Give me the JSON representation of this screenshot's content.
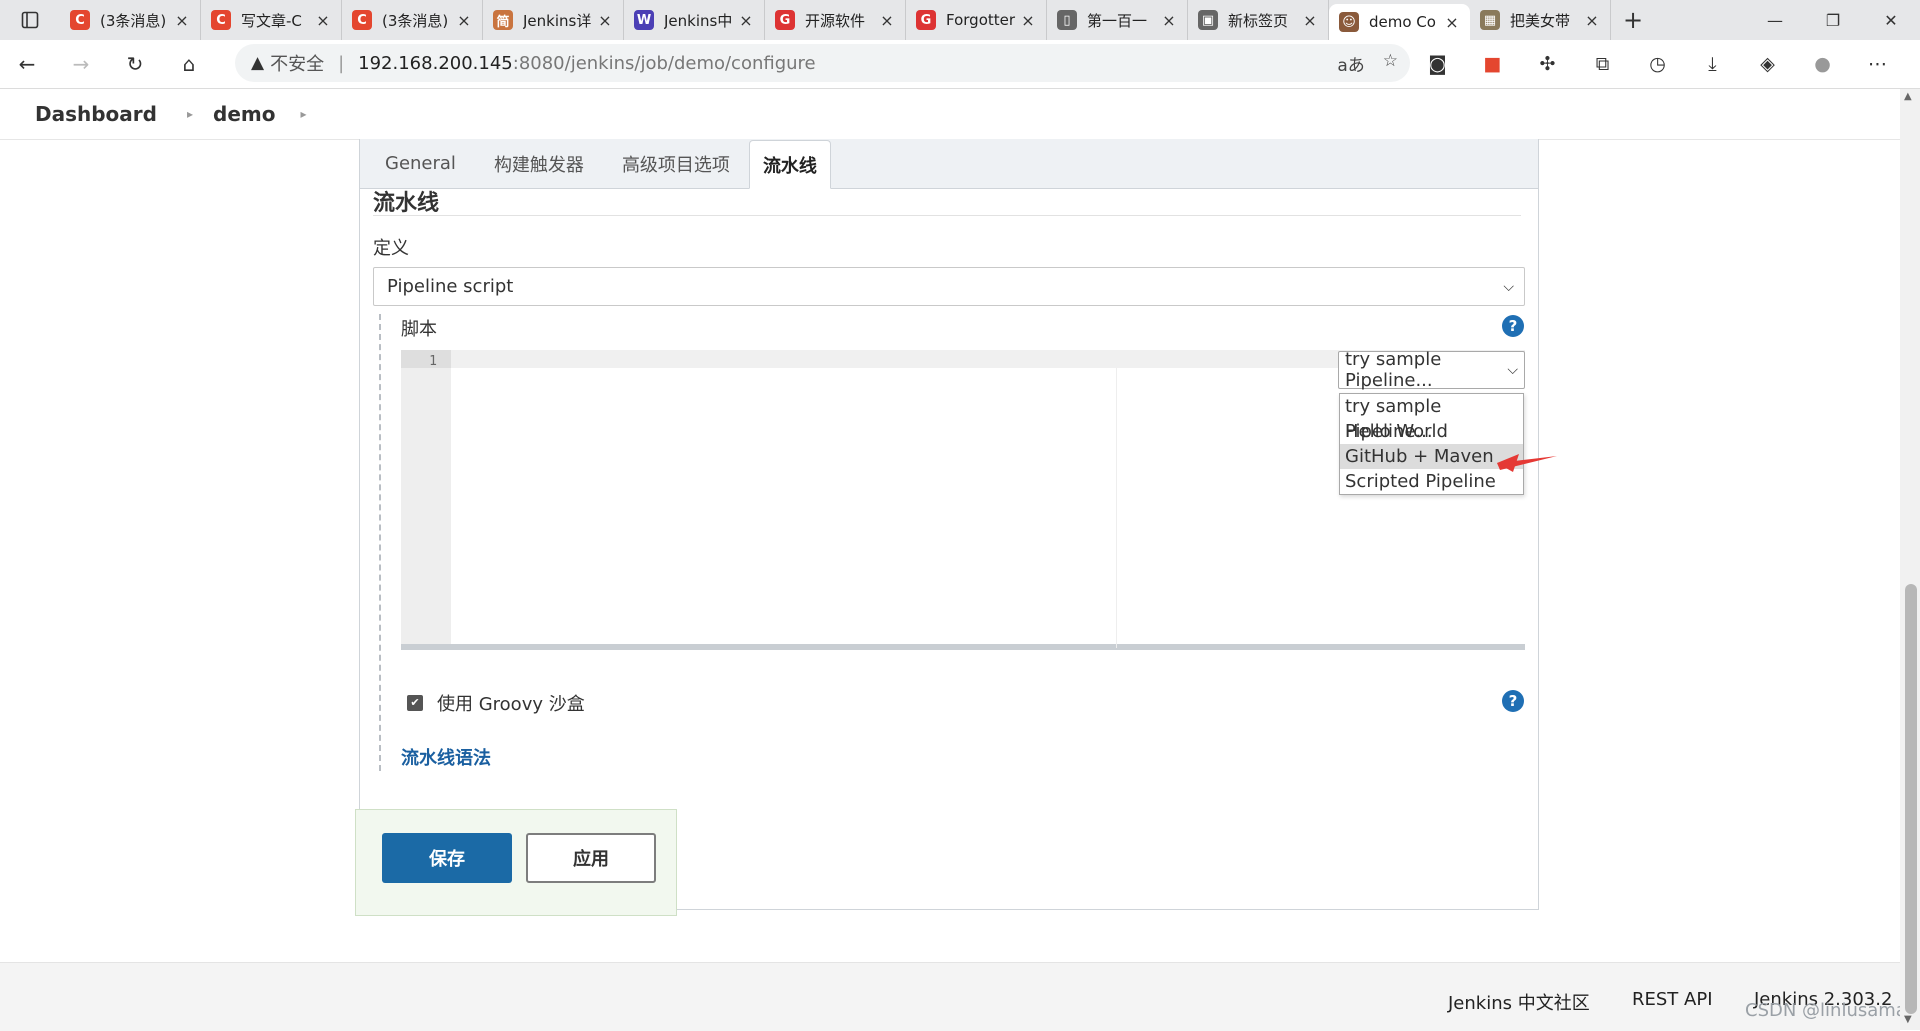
{
  "browser": {
    "tabs": [
      {
        "title": "(3条消息)",
        "favicon": "C",
        "color": "#e4462f"
      },
      {
        "title": "写文章-C",
        "favicon": "C",
        "color": "#e4462f"
      },
      {
        "title": "(3条消息)",
        "favicon": "C",
        "color": "#e4462f"
      },
      {
        "title": "Jenkins详",
        "favicon": "简",
        "color": "#c9743f"
      },
      {
        "title": "Jenkins中",
        "favicon": "W",
        "color": "#4b3fb5"
      },
      {
        "title": "开源软件",
        "favicon": "G",
        "color": "#d33"
      },
      {
        "title": "Forgotter",
        "favicon": "G",
        "color": "#d33"
      },
      {
        "title": "第一百一",
        "favicon": "▯",
        "color": "#666"
      },
      {
        "title": "新标签页",
        "favicon": "▣",
        "color": "#666"
      },
      {
        "title": "demo Co",
        "favicon": "☺",
        "color": "#8a5a3b",
        "active": true
      },
      {
        "title": "把美女带",
        "favicon": "▦",
        "color": "#8a7a5b"
      }
    ],
    "url_insecure": "不安全",
    "url_host": "192.168.200.145",
    "url_path": ":8080/jenkins/job/demo/configure"
  },
  "breadcrumb": {
    "dashboard": "Dashboard",
    "job": "demo"
  },
  "config": {
    "tabs": [
      "General",
      "构建触发器",
      "高级项目选项",
      "流水线"
    ],
    "active_tab": "流水线",
    "section_title": "流水线",
    "definition_label": "定义",
    "definition_value": "Pipeline script",
    "script_label": "脚本",
    "line_number": "1",
    "sample_select_value": "try sample Pipeline...",
    "sample_options": [
      "try sample Pipeline...",
      "Hello World",
      "GitHub + Maven",
      "Scripted Pipeline"
    ],
    "highlighted_option": "GitHub + Maven",
    "sandbox_label": "使用 Groovy 沙盒",
    "sandbox_checked": true,
    "syntax_link": "流水线语法",
    "save_button": "保存",
    "apply_button": "应用",
    "help_glyph": "?"
  },
  "footer": {
    "community": "Jenkins 中文社区",
    "rest_api": "REST API",
    "version": "Jenkins 2.303.2"
  },
  "watermark": "CSDN @linlusama",
  "colors": {
    "accent_blue": "#1b6aa6",
    "annotation_arrow": "#e53935"
  }
}
